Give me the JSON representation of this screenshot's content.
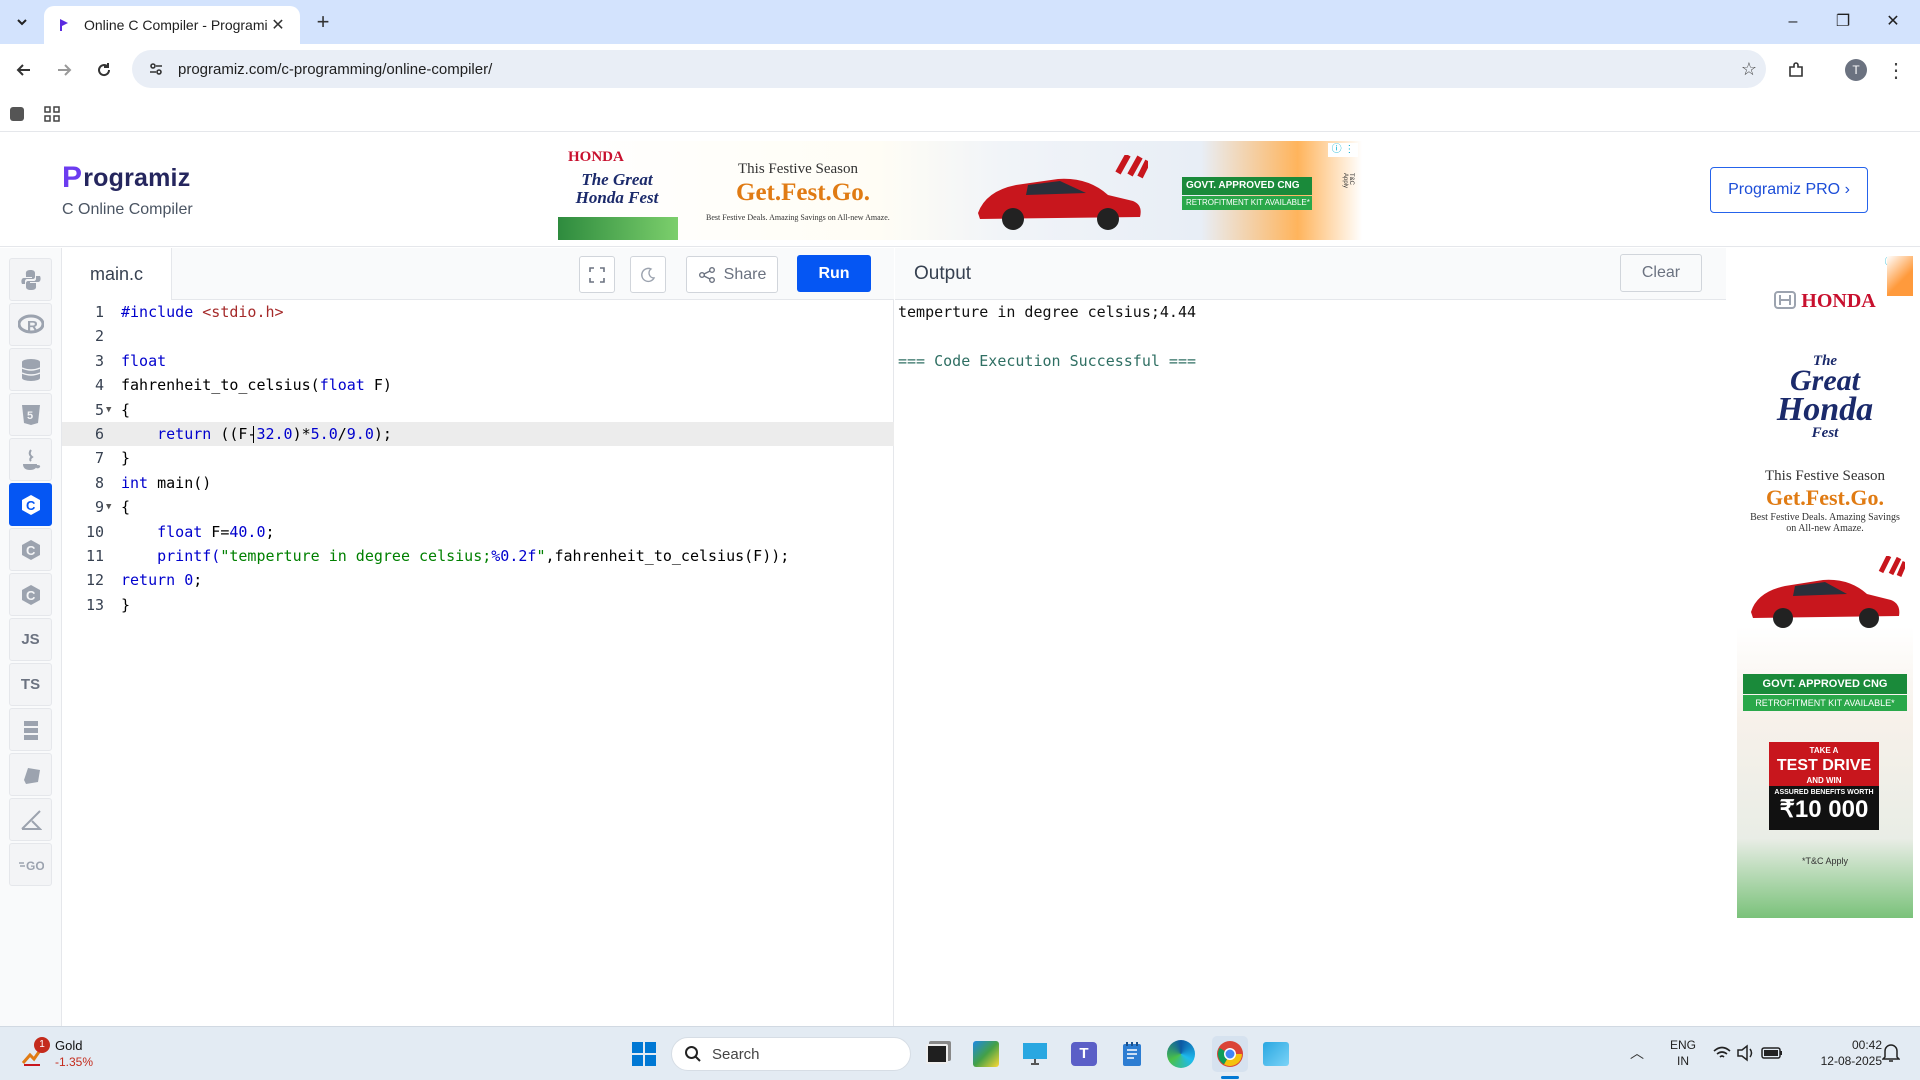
{
  "browser": {
    "tab_title": "Online C Compiler - Programiz",
    "url": "programiz.com/c-programming/online-compiler/"
  },
  "site": {
    "logo_text": "rogramiz",
    "logo_letter": "P",
    "subtitle": "C Online Compiler",
    "pro_button": "Programiz PRO ›"
  },
  "top_ad": {
    "brand": "HONDA",
    "fest": "The Great Honda Fest",
    "season": "This Festive Season",
    "headline": "Get.Fest.Go.",
    "tagline": "Best Festive Deals. Amazing Savings on All-new Amaze.",
    "badge": "GOVT. APPROVED",
    "badge_cng": "CNG",
    "badge_kit": "RETROFITMENT KIT AVAILABLE*",
    "tc": "T&C Apply"
  },
  "rail": {
    "js": "JS",
    "ts": "TS"
  },
  "editor": {
    "file_name": "main.c",
    "share_label": "Share",
    "run_label": "Run",
    "lines": {
      "l1a": "#include ",
      "l1b": "<stdio.h>",
      "l3": "float",
      "l4a": "fahrenheit_to_celsius(",
      "l4b": "float",
      "l4c": " F)",
      "l5": "{",
      "l6a": "    return ",
      "l6b": "((F-",
      "l6c": "32.0",
      "l6d": ")*",
      "l6e": "5.0",
      "l6f": "/",
      "l6g": "9.0",
      "l6h": ");",
      "l7": "}",
      "l8a": "int",
      "l8b": " main()",
      "l9": "{",
      "l10a": "    float",
      "l10b": " F=",
      "l10c": "40.0",
      "l10d": ";",
      "l11a": "    printf(",
      "l11b": "\"temperture in degree celsius;",
      "l11c": "%0.2f",
      "l11d": "\"",
      "l11e": ",fahrenheit_to_celsius(F));",
      "l12a": "return",
      "l12b": " ",
      "l12c": "0",
      "l12d": ";",
      "l13": "}"
    },
    "line_numbers": [
      "1",
      "2",
      "3",
      "4",
      "5",
      "6",
      "7",
      "8",
      "9",
      "10",
      "11",
      "12",
      "13"
    ]
  },
  "output": {
    "title": "Output",
    "clear_label": "Clear",
    "line1": "temperture in degree celsius;4.44",
    "line2": "=== Code Execution Successful ==="
  },
  "side_ad": {
    "brand": "HONDA",
    "fest_the": "The",
    "fest_great": "Great",
    "fest_honda": "Honda",
    "fest_fest": "Fest",
    "season": "This Festive Season",
    "headline": "Get.Fest.Go.",
    "tagline": "Best Festive Deals. Amazing Savings on All-new Amaze.",
    "badge": "GOVT. APPROVED",
    "badge_cng": "CNG",
    "badge_kit": "RETROFITMENT KIT AVAILABLE*",
    "take_a": "TAKE A",
    "test_drive": "TEST DRIVE",
    "and_win": "AND WIN",
    "assured": "ASSURED BENEFITS WORTH",
    "amount": "₹10 000",
    "tc": "*T&C Apply"
  },
  "taskbar": {
    "widget_title": "Gold",
    "widget_value": "-1.35%",
    "widget_badge": "1",
    "search_placeholder": "Search",
    "lang_top": "ENG",
    "lang_bottom": "IN",
    "time": "00:42",
    "date": "12-08-2025"
  },
  "colors": {
    "accent": "#0556f3",
    "tabstrip": "#d3e3fd",
    "keyword": "#0000cd",
    "string": "#008000",
    "include": "#a52a2a"
  }
}
